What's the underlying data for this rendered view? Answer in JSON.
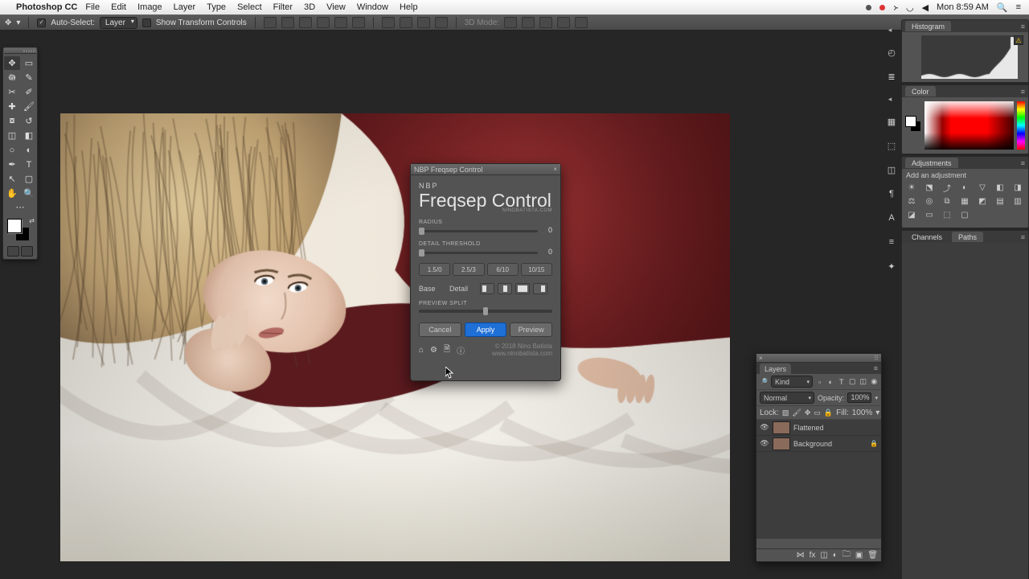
{
  "macmenu": {
    "appname": "Photoshop CC",
    "items": [
      "File",
      "Edit",
      "Image",
      "Layer",
      "Type",
      "Select",
      "Filter",
      "3D",
      "View",
      "Window",
      "Help"
    ],
    "clock": "Mon 8:59 AM"
  },
  "options": {
    "autoselect_label": "Auto-Select:",
    "autoselect_value": "Layer",
    "show_tf": "Show Transform Controls",
    "mode3d": "3D Mode:"
  },
  "plugin": {
    "title": "NBP Freqsep Control",
    "brand_top": "NBP",
    "brand_big_a": "Freqsep ",
    "brand_big_b": "Control",
    "brand_sub": "NINOBATISTA.COM",
    "radius_label": "RADIUS",
    "radius_value": "0",
    "detail_label": "DETAIL THRESHOLD",
    "detail_value": "0",
    "presets": [
      "1.5/0",
      "2.5/3",
      "6/10",
      "10/15"
    ],
    "base": "Base",
    "detail": "Detail",
    "prevsplit": "PREVIEW SPLIT",
    "cancel": "Cancel",
    "apply": "Apply",
    "preview": "Preview",
    "credit1": "© 2018 Nino Batista",
    "credit2": "www.ninobatista.com"
  },
  "panels": {
    "histogram": "Histogram",
    "color": "Color",
    "adjustments": "Adjustments",
    "adj_sub": "Add an adjustment",
    "channels": "Channels",
    "paths": "Paths"
  },
  "layers": {
    "title": "Layers",
    "kind": "Kind",
    "mode": "Normal",
    "opacity_label": "Opacity:",
    "opacity_value": "100%",
    "lock_label": "Lock:",
    "fill_label": "Fill:",
    "fill_value": "100%",
    "items": [
      {
        "name": "Flattened",
        "locked": false
      },
      {
        "name": "Background",
        "locked": true
      }
    ]
  }
}
